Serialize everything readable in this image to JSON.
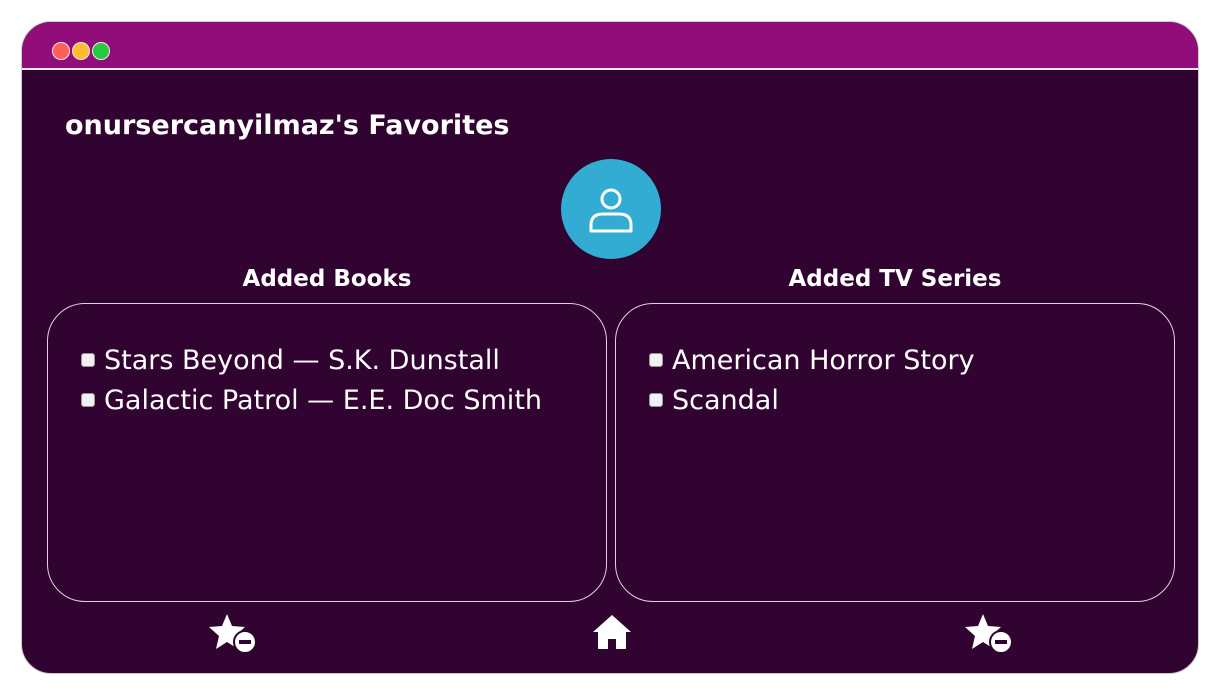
{
  "header": {
    "title": "onursercanyilmaz's Favorites"
  },
  "sections": {
    "books": {
      "title": "Added Books",
      "items": [
        {
          "label": "Stars Beyond — S.K. Dunstall"
        },
        {
          "label": "Galactic Patrol — E.E. Doc Smith"
        }
      ]
    },
    "tv": {
      "title": "Added TV Series",
      "items": [
        {
          "label": "American Horror Story"
        },
        {
          "label": "Scandal"
        }
      ]
    }
  },
  "icons": {
    "avatar": "user-icon",
    "remove_books": "star-remove-icon",
    "home": "home-icon",
    "remove_tv": "star-remove-icon"
  },
  "colors": {
    "background": "#310330",
    "titlebar": "#910e7a",
    "avatar": "#32acd3"
  }
}
